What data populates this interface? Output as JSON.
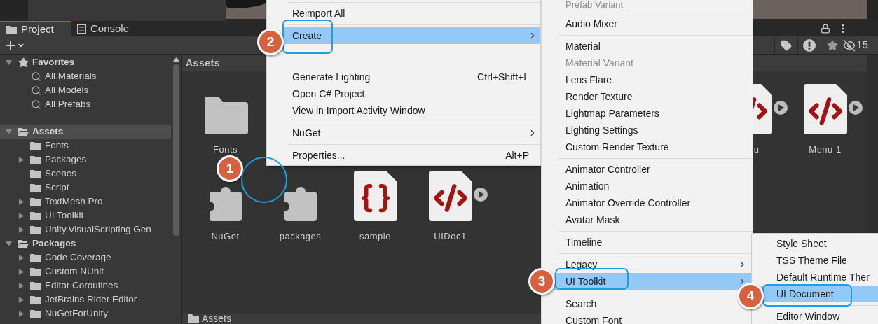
{
  "tabs": [
    {
      "label": "Project",
      "kind": "folder",
      "selected": true
    },
    {
      "label": "Console",
      "kind": "console",
      "selected": false
    }
  ],
  "filter_buttons": [
    {
      "kind": "tag"
    },
    {
      "kind": "warning"
    },
    {
      "kind": "star"
    },
    {
      "kind": "hidden",
      "count": "15"
    }
  ],
  "tree": [
    {
      "label": "Favorites",
      "kind": "star",
      "expanded": true,
      "selected": false,
      "children": [
        {
          "label": "All Materials",
          "kind": "search",
          "selected": false
        },
        {
          "label": "All Models",
          "kind": "search",
          "selected": false
        },
        {
          "label": "All Prefabs",
          "kind": "search",
          "selected": false
        }
      ]
    },
    {
      "label": "Assets",
      "kind": "folder_open",
      "expanded": true,
      "selected": true,
      "children": [
        {
          "label": "Fonts",
          "kind": "folder",
          "selected": false
        },
        {
          "label": "Packages",
          "kind": "folder",
          "expanded": false,
          "selected": false
        },
        {
          "label": "Scenes",
          "kind": "folder",
          "selected": false
        },
        {
          "label": "Script",
          "kind": "folder",
          "selected": false
        },
        {
          "label": "TextMesh Pro",
          "kind": "folder",
          "expanded": false,
          "selected": false
        },
        {
          "label": "UI Toolkit",
          "kind": "folder",
          "expanded": false,
          "selected": false
        },
        {
          "label": "Unity.VisualScripting.Gen",
          "kind": "folder",
          "expanded": false,
          "selected": false
        }
      ]
    },
    {
      "label": "Packages",
      "kind": "folder_open",
      "expanded": true,
      "selected": false,
      "children": [
        {
          "label": "Code Coverage",
          "kind": "folder",
          "expanded": false,
          "selected": false
        },
        {
          "label": "Custom NUnit",
          "kind": "folder",
          "expanded": false,
          "selected": false
        },
        {
          "label": "Editor Coroutines",
          "kind": "folder",
          "expanded": false,
          "selected": false
        },
        {
          "label": "JetBrains Rider Editor",
          "kind": "folder",
          "expanded": false,
          "selected": false
        },
        {
          "label": "NuGetForUnity",
          "kind": "folder",
          "expanded": false,
          "selected": false
        }
      ]
    }
  ],
  "grid_header": "Assets",
  "asset_rows": [
    [
      {
        "label": "Fonts",
        "kind": "folder",
        "play": false
      },
      {
        "label": "u",
        "kind": "uxml",
        "play": true
      },
      {
        "label": "Menu 1",
        "kind": "uxml",
        "play": true
      }
    ],
    [
      {
        "label": "NuGet",
        "kind": "package",
        "play": false
      },
      {
        "label": "packages",
        "kind": "package",
        "play": false
      },
      {
        "label": "sample",
        "kind": "json",
        "play": false
      },
      {
        "label": "UIDoc1",
        "kind": "uxml",
        "play": true
      }
    ]
  ],
  "breadcrumb": "Assets",
  "context_menu": [
    {
      "kind": "separator"
    },
    {
      "kind": "item",
      "label": "Reimport All",
      "selected": false,
      "submenu": false
    },
    {
      "kind": "separator"
    },
    {
      "kind": "item",
      "label": "Create",
      "selected": true,
      "submenu": true
    },
    {
      "kind": "blank"
    },
    {
      "kind": "item",
      "label": "Generate Lighting",
      "shortcut": "Ctrl+Shift+L",
      "selected": false,
      "submenu": false
    },
    {
      "kind": "item",
      "label": "Open C# Project",
      "selected": false,
      "submenu": false
    },
    {
      "kind": "item",
      "label": "View in Import Activity Window",
      "selected": false,
      "submenu": false
    },
    {
      "kind": "separator"
    },
    {
      "kind": "item",
      "label": "NuGet",
      "selected": false,
      "submenu": true
    },
    {
      "kind": "separator"
    },
    {
      "kind": "item",
      "label": "Properties...",
      "shortcut": "Alt+P",
      "selected": false,
      "submenu": false
    }
  ],
  "create_menu": [
    {
      "kind": "top",
      "label": "Prefab Variant",
      "disabled": true,
      "selected": false,
      "submenu": false
    },
    {
      "kind": "separator"
    },
    {
      "kind": "item",
      "label": "Audio Mixer",
      "disabled": false,
      "selected": false,
      "submenu": false
    },
    {
      "kind": "separator"
    },
    {
      "kind": "item",
      "label": "Material",
      "disabled": false,
      "selected": false,
      "submenu": false
    },
    {
      "kind": "item",
      "label": "Material Variant",
      "disabled": true,
      "selected": false,
      "submenu": false
    },
    {
      "kind": "item",
      "label": "Lens Flare",
      "disabled": false,
      "selected": false,
      "submenu": false
    },
    {
      "kind": "item",
      "label": "Render Texture",
      "disabled": false,
      "selected": false,
      "submenu": false
    },
    {
      "kind": "item",
      "label": "Lightmap Parameters",
      "disabled": false,
      "selected": false,
      "submenu": false
    },
    {
      "kind": "item",
      "label": "Lighting Settings",
      "disabled": false,
      "selected": false,
      "submenu": false
    },
    {
      "kind": "item",
      "label": "Custom Render Texture",
      "disabled": false,
      "selected": false,
      "submenu": false
    },
    {
      "kind": "separator"
    },
    {
      "kind": "item",
      "label": "Animator Controller",
      "disabled": false,
      "selected": false,
      "submenu": false
    },
    {
      "kind": "item",
      "label": "Animation",
      "disabled": false,
      "selected": false,
      "submenu": false
    },
    {
      "kind": "item",
      "label": "Animator Override Controller",
      "disabled": false,
      "selected": false,
      "submenu": false
    },
    {
      "kind": "item",
      "label": "Avatar Mask",
      "disabled": false,
      "selected": false,
      "submenu": false
    },
    {
      "kind": "separator"
    },
    {
      "kind": "item",
      "label": "Timeline",
      "disabled": false,
      "selected": false,
      "submenu": false
    },
    {
      "kind": "separator"
    },
    {
      "kind": "item",
      "label": "Legacy",
      "disabled": false,
      "selected": false,
      "submenu": true
    },
    {
      "kind": "item",
      "label": "UI Toolkit",
      "disabled": false,
      "selected": true,
      "submenu": true
    },
    {
      "kind": "separator"
    },
    {
      "kind": "item",
      "label": "Search",
      "disabled": false,
      "selected": false,
      "submenu": false
    },
    {
      "kind": "item",
      "label": "Custom Font",
      "disabled": false,
      "selected": false,
      "submenu": false
    }
  ],
  "ui_toolkit_menu": [
    {
      "kind": "item",
      "label": "Style Sheet",
      "selected": false
    },
    {
      "kind": "item",
      "label": "TSS Theme File",
      "selected": false
    },
    {
      "kind": "item",
      "label": "Default Runtime Ther",
      "selected": false
    },
    {
      "kind": "item",
      "label": "UI Document",
      "selected": true
    },
    {
      "kind": "separator"
    },
    {
      "kind": "item",
      "label": "Editor Window",
      "selected": false
    }
  ],
  "annotations": [
    {
      "number": "1"
    },
    {
      "number": "2"
    },
    {
      "number": "3"
    },
    {
      "number": "4"
    }
  ]
}
